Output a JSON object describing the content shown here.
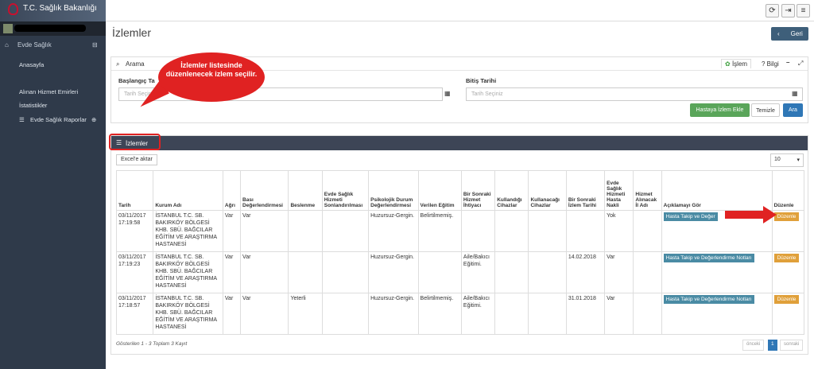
{
  "app": {
    "brand": "T.C. Sağlık Bakanlığı"
  },
  "header": {
    "icons": [
      "refresh-icon",
      "logout-icon",
      "menu-icon"
    ]
  },
  "sidebar": {
    "section": "Evde Sağlık",
    "items": [
      {
        "label": "Anasayfa"
      },
      {
        "label": "Alınan Hizmet Emirleri"
      },
      {
        "label": "İstatistikler"
      },
      {
        "label": "Evde Sağlık Raporlar"
      }
    ]
  },
  "page": {
    "title": "İzlemler",
    "back": "Geri"
  },
  "search": {
    "title": "Arama",
    "tab_islem": "İşlem",
    "tab_bilgi": "Bilgi",
    "start_label": "Başlangıç Ta",
    "start_placeholder": "Tarih Seçiniz",
    "end_label": "Bitiş Tarihi",
    "end_placeholder": "Tarih Seçiniz",
    "btn_add": "Hastaya İzlem Ekle",
    "btn_clear": "Temizle",
    "btn_search": "Ara"
  },
  "callout": {
    "text": "İzlemler listesinde düzenlenecek izlem seçilir."
  },
  "list": {
    "title": "İzlemler",
    "excel": "Excel'e aktar",
    "page_size": "10",
    "columns": [
      "Tarih",
      "Kurum Adı",
      "Ağrı",
      "Bası Değerlendirmesi",
      "Beslenme",
      "Evde Sağlık Hizmeti Sonlandırılması",
      "Psikolojik Durum Değerlendirmesi",
      "Verilen Eğitim",
      "Bir Sonraki Hizmet İhtiyacı",
      "Kullandığı Cihazlar",
      "Kullanacağı Cihazlar",
      "Bir Sonraki İzlem Tarihi",
      "Evde Sağlık Hizmeti Hasta Nakli",
      "Hizmet Alınacak İl Adı",
      "Açıklamayı Gör",
      "Düzenle"
    ],
    "rows": [
      {
        "tarih": "03/11/2017 17:19:58",
        "kurum": "İSTANBUL T.C. SB. BAKIRKÖY BÖLGESİ KHB. SBÜ. BAĞCILAR EĞİTİM VE ARAŞTIRMA HASTANESİ",
        "agri": "Var",
        "basi": "Var",
        "beslenme": "",
        "sonl": "",
        "psiko": "Huzursuz-Gergin.",
        "egitim": "Belirtilmemiş.",
        "ihtiyac": "",
        "kullandigi": "",
        "kullanacagi": "",
        "izlem": "",
        "nakli": "Yok",
        "il": "",
        "aciklama": "Hasta Takip ve Değer",
        "duzenle": "Düzenle"
      },
      {
        "tarih": "03/11/2017 17:19:23",
        "kurum": "İSTANBUL T.C. SB. BAKIRKÖY BÖLGESİ KHB. SBÜ. BAĞCILAR EĞİTİM VE ARAŞTIRMA HASTANESİ",
        "agri": "Var",
        "basi": "Var",
        "beslenme": "",
        "sonl": "",
        "psiko": "Huzursuz-Gergin.",
        "egitim": "",
        "ihtiyac": "Aile/Bakıcı Eğitimi.",
        "kullandigi": "",
        "kullanacagi": "",
        "izlem": "14.02.2018",
        "nakli": "Var",
        "il": "",
        "aciklama": "Hasta Takip ve Değerlendirme Notları",
        "duzenle": "Düzenle"
      },
      {
        "tarih": "03/11/2017 17:18:57",
        "kurum": "İSTANBUL T.C. SB. BAKIRKÖY BÖLGESİ KHB. SBÜ. BAĞCILAR EĞİTİM VE ARAŞTIRMA HASTANESİ",
        "agri": "Var",
        "basi": "Var",
        "beslenme": "Yeterli",
        "sonl": "",
        "psiko": "Huzursuz-Gergin.",
        "egitim": "Belirtilmemiş.",
        "ihtiyac": "Aile/Bakıcı Eğitimi.",
        "kullandigi": "",
        "kullanacagi": "",
        "izlem": "31.01.2018",
        "nakli": "Var",
        "il": "",
        "aciklama": "Hasta Takip ve Değerlendirme Notları",
        "duzenle": "Düzenle"
      }
    ],
    "footer": "Gösterilen 1 - 3 Toplam 3 Kayıt",
    "prev": "önceki",
    "page": "1",
    "next": "sonraki"
  },
  "colors": {
    "sidebar": "#2f3a4a",
    "panel_header": "#3d4556",
    "accent_red": "#e02222",
    "edit": "#e0a03a",
    "note": "#4a8ba4"
  }
}
